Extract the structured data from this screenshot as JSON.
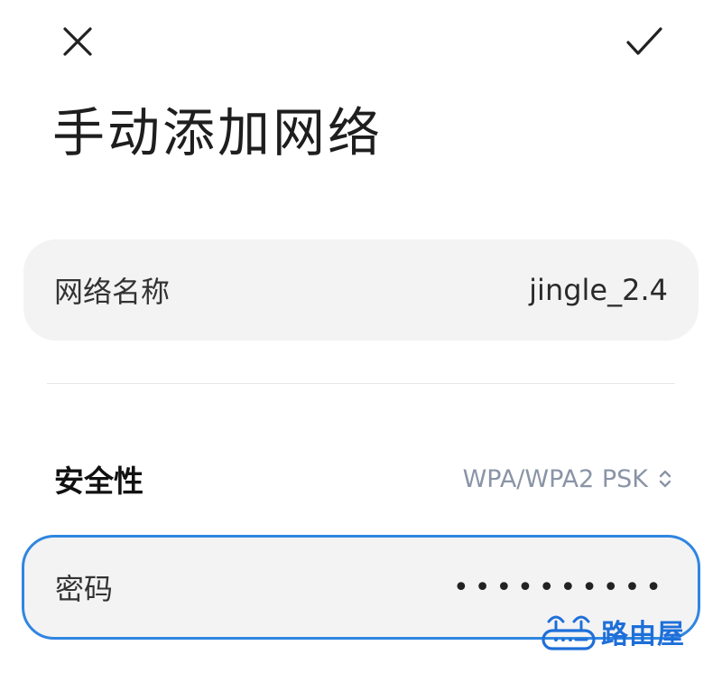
{
  "header": {
    "close_icon": "close-icon",
    "confirm_icon": "checkmark-icon"
  },
  "page_title": "手动添加网络",
  "ssid_field": {
    "label": "网络名称",
    "value": "jingle_2.4"
  },
  "security": {
    "label": "安全性",
    "value": "WPA/WPA2 PSK",
    "icon": "chevron-up-down-icon"
  },
  "password_field": {
    "label": "密码",
    "masked_value": "••••••••••",
    "focus_color": "#2f86e0"
  },
  "watermark": {
    "text": "路由屋",
    "color": "#1e6fd9"
  }
}
